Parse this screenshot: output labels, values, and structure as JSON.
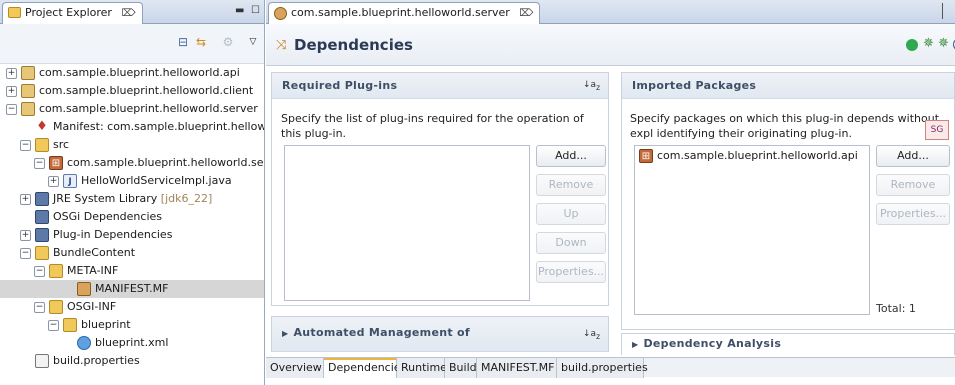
{
  "explorer": {
    "tab_label": "Project Explorer",
    "tab_close": "⌦",
    "tree": [
      {
        "label": "com.sample.blueprint.helloworld.api",
        "expander": "+",
        "icon": "project-icon",
        "depth": 0
      },
      {
        "label": "com.sample.blueprint.helloworld.client",
        "expander": "+",
        "icon": "project-icon",
        "depth": 0
      },
      {
        "label": "com.sample.blueprint.helloworld.server",
        "expander": "−",
        "icon": "project-icon",
        "depth": 0
      },
      {
        "label": "Manifest: com.sample.blueprint.helloworl",
        "expander": "",
        "icon": "manifest-icon",
        "depth": 1
      },
      {
        "label": "src",
        "expander": "−",
        "icon": "source-folder-icon",
        "depth": 1
      },
      {
        "label": "com.sample.blueprint.helloworld.serve",
        "expander": "−",
        "icon": "package-icon",
        "depth": 2
      },
      {
        "label": "HelloWorldServiceImpl.java",
        "expander": "+",
        "icon": "java-file-icon",
        "depth": 3
      },
      {
        "label": "JRE System Library",
        "suffix": "[jdk6_22]",
        "expander": "+",
        "icon": "library-icon",
        "depth": 1
      },
      {
        "label": "OSGi Dependencies",
        "expander": "",
        "icon": "library-icon",
        "depth": 1
      },
      {
        "label": "Plug-in Dependencies",
        "expander": "+",
        "icon": "library-icon",
        "depth": 1
      },
      {
        "label": "BundleContent",
        "expander": "−",
        "icon": "folder-icon",
        "depth": 1
      },
      {
        "label": "META-INF",
        "expander": "−",
        "icon": "folder-icon",
        "depth": 2
      },
      {
        "label": "MANIFEST.MF",
        "expander": "",
        "icon": "manifest-file-icon",
        "depth": 4,
        "selected": true
      },
      {
        "label": "OSGI-INF",
        "expander": "−",
        "icon": "folder-icon",
        "depth": 2
      },
      {
        "label": "blueprint",
        "expander": "−",
        "icon": "folder-icon",
        "depth": 3
      },
      {
        "label": "blueprint.xml",
        "expander": "",
        "icon": "xml-file-icon",
        "depth": 4
      },
      {
        "label": "build.properties",
        "expander": "",
        "icon": "properties-file-icon",
        "depth": 1
      }
    ]
  },
  "editor": {
    "tab_label": "com.sample.blueprint.helloworld.server",
    "tab_close": "⌦",
    "title": "Dependencies",
    "required": {
      "heading": "Required Plug-ins",
      "description": "Specify the list of plug-ins required for the operation of this plug-in.",
      "items": [],
      "buttons": [
        "Add...",
        "Remove",
        "Up",
        "Down",
        "Properties..."
      ]
    },
    "imported": {
      "heading": "Imported Packages",
      "description": "Specify packages on which this plug-in depends without expl identifying their originating plug-in.",
      "items": [
        "com.sample.blueprint.helloworld.api"
      ],
      "buttons": [
        "Add...",
        "Remove",
        "Properties..."
      ],
      "total": "Total: 1"
    },
    "automated": {
      "heading": "Automated Management of"
    },
    "analysis": {
      "heading": "Dependency Analysis"
    },
    "bottom_tabs": [
      "Overview",
      "Dependencies",
      "Runtime",
      "Build",
      "MANIFEST.MF",
      "build.properties"
    ],
    "active_tab": "Dependencies"
  },
  "colors": {
    "accent": "#f0b43c",
    "selection": "#d6d6d6",
    "header_text": "#2b3b55"
  }
}
